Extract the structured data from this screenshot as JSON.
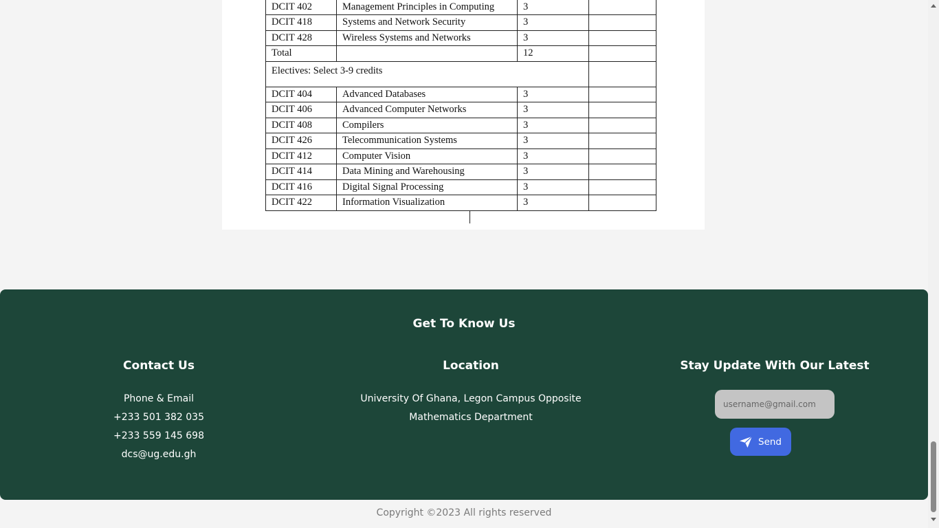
{
  "course_table": {
    "rows": [
      {
        "code": "DCIT 402",
        "title": "Management Principles in Computing",
        "credits": "3",
        "grade": ""
      },
      {
        "code": "DCIT 418",
        "title": "Systems and Network Security",
        "credits": "3",
        "grade": ""
      },
      {
        "code": "DCIT 428",
        "title": "Wireless Systems and Networks",
        "credits": "3",
        "grade": ""
      },
      {
        "code": "Total",
        "title": "",
        "credits": "12",
        "grade": ""
      }
    ],
    "electives_label": "Electives: Select 3-9 credits",
    "elective_rows": [
      {
        "code": "DCIT 404",
        "title": "Advanced Databases",
        "credits": "3",
        "grade": ""
      },
      {
        "code": "DCIT 406",
        "title": "Advanced Computer Networks",
        "credits": "3",
        "grade": ""
      },
      {
        "code": "DCIT 408",
        "title": "Compilers",
        "credits": "3",
        "grade": ""
      },
      {
        "code": "DCIT 426",
        "title": "Telecommunication Systems",
        "credits": "3",
        "grade": ""
      },
      {
        "code": "DCIT 412",
        "title": "Computer Vision",
        "credits": "3",
        "grade": ""
      },
      {
        "code": "DCIT 414",
        "title": "Data Mining and Warehousing",
        "credits": "3",
        "grade": ""
      },
      {
        "code": "DCIT 416",
        "title": "Digital Signal Processing",
        "credits": "3",
        "grade": ""
      },
      {
        "code": "DCIT 422",
        "title": "Information Visualization",
        "credits": "3",
        "grade": ""
      }
    ]
  },
  "footer": {
    "heading": "Get To Know Us",
    "contact": {
      "title": "Contact Us",
      "lines": [
        "Phone & Email",
        "+233 501 382 035",
        "+233 559 145 698",
        "dcs@ug.edu.gh"
      ]
    },
    "location": {
      "title": "Location",
      "lines": [
        "University Of Ghana, Legon Campus Opposite",
        "Mathematics Department"
      ]
    },
    "subscribe": {
      "title": "Stay Update With Our Latest",
      "email_placeholder": "username@gmail.com",
      "send_label": "Send"
    },
    "background_color": "#1d4639",
    "button_color": "#4169e1"
  },
  "copyright": "Copyright ©2023 All rights reserved",
  "icons": {
    "send": "paper-plane-icon"
  }
}
